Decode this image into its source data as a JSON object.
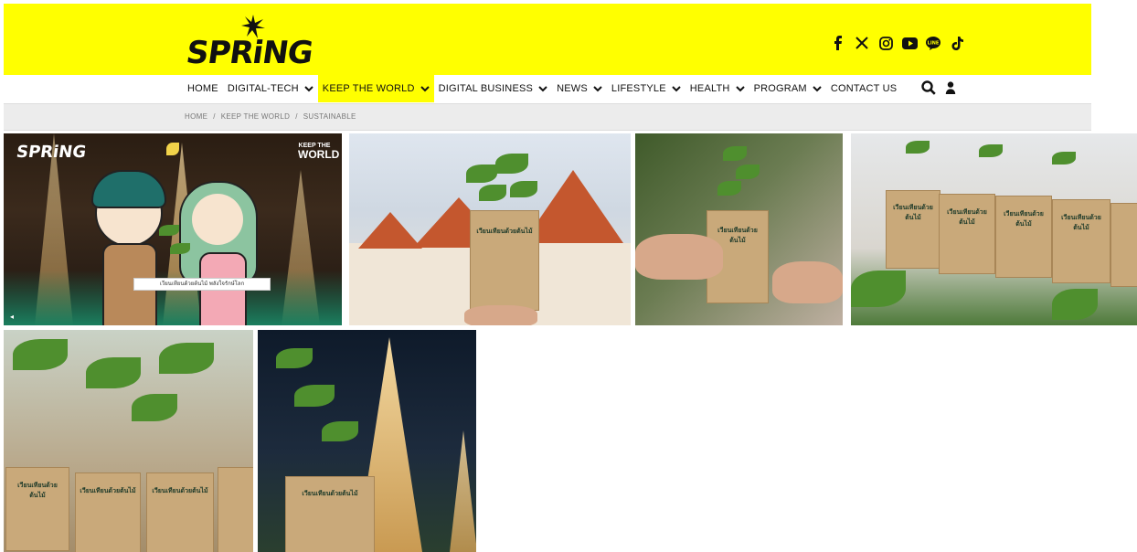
{
  "header": {
    "logo_text": "SPRiNG",
    "social_icons": [
      "facebook-icon",
      "x-icon",
      "instagram-icon",
      "youtube-icon",
      "line-icon",
      "tiktok-icon"
    ],
    "background": "#ffff00"
  },
  "nav": {
    "items": [
      {
        "label": "HOME",
        "dropdown": false,
        "active": false
      },
      {
        "label": "DIGITAL-TECH",
        "dropdown": true,
        "active": false
      },
      {
        "label": "KEEP THE WORLD",
        "dropdown": true,
        "active": true
      },
      {
        "label": "DIGITAL BUSINESS",
        "dropdown": true,
        "active": false
      },
      {
        "label": "NEWS",
        "dropdown": true,
        "active": false
      },
      {
        "label": "LIFESTYLE",
        "dropdown": true,
        "active": false
      },
      {
        "label": "HEALTH",
        "dropdown": true,
        "active": false
      },
      {
        "label": "PROGRAM",
        "dropdown": true,
        "active": false
      },
      {
        "label": "CONTACT US",
        "dropdown": false,
        "active": false
      }
    ],
    "tools": [
      "search-icon",
      "user-icon"
    ]
  },
  "breadcrumb": {
    "items": [
      "HOME",
      "KEEP THE WORLD",
      "SUSTAINABLE"
    ],
    "separator": "/"
  },
  "gallery": {
    "photo1": {
      "logo_text": "SPRiNG",
      "badge_top": "KEEP THE",
      "badge_bottom": "WORLD",
      "caption": "เวียนเทียนด้วยต้นไม้ พลังใจรักษ์โลก"
    },
    "bag_label": "เวียนเทียนด้วยต้นไม้"
  }
}
